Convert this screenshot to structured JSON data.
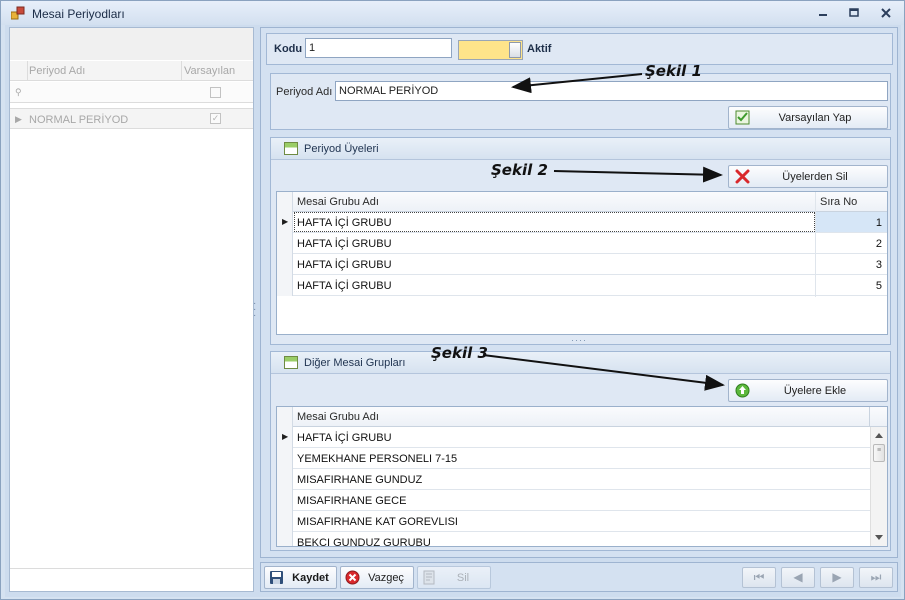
{
  "window": {
    "title": "Mesai Periyodları"
  },
  "left_grid": {
    "columns": [
      "Periyod Adı",
      "Varsayılan"
    ],
    "rows": [
      {
        "name": "NORMAL PERİYOD",
        "default": true
      }
    ]
  },
  "header": {
    "kodu_label": "Kodu",
    "kodu_value": "1",
    "aktif_label": "Aktif"
  },
  "periyod": {
    "label": "Periyod Adı",
    "value": "NORMAL PERİYOD",
    "default_button": "Varsayılan Yap"
  },
  "uyeler": {
    "title": "Periyod Üyeleri",
    "remove_button": "Üyelerden Sil",
    "columns": [
      "Mesai Grubu Adı",
      "Sıra No"
    ],
    "rows": [
      {
        "name": "HAFTA İÇİ GRUBU",
        "order": "1"
      },
      {
        "name": "HAFTA İÇİ GRUBU",
        "order": "2"
      },
      {
        "name": "HAFTA İÇİ GRUBU",
        "order": "3"
      },
      {
        "name": "HAFTA İÇİ GRUBU",
        "order": "5"
      }
    ]
  },
  "diger": {
    "title": "Diğer Mesai Grupları",
    "add_button": "Üyelere Ekle",
    "columns": [
      "Mesai Grubu Adı"
    ],
    "rows": [
      "HAFTA İÇİ GRUBU",
      "YEMEKHANE PERSONELI  7-15",
      "MISAFIRHANE GUNDUZ",
      "MISAFIRHANE GECE",
      "MISAFIRHANE KAT GOREVLISI",
      "BEKCI GUNDUZ GURUBU"
    ]
  },
  "annotations": {
    "a1": "Şekil 1",
    "a2": "Şekil 2",
    "a3": "Şekil 3"
  },
  "toolbar": {
    "save": "Kaydet",
    "cancel": "Vazgeç",
    "delete": "Sil"
  },
  "colors": {
    "toggle": "#ffe48a",
    "accent_green": "#3e9b2e",
    "danger_red": "#d9282c"
  }
}
